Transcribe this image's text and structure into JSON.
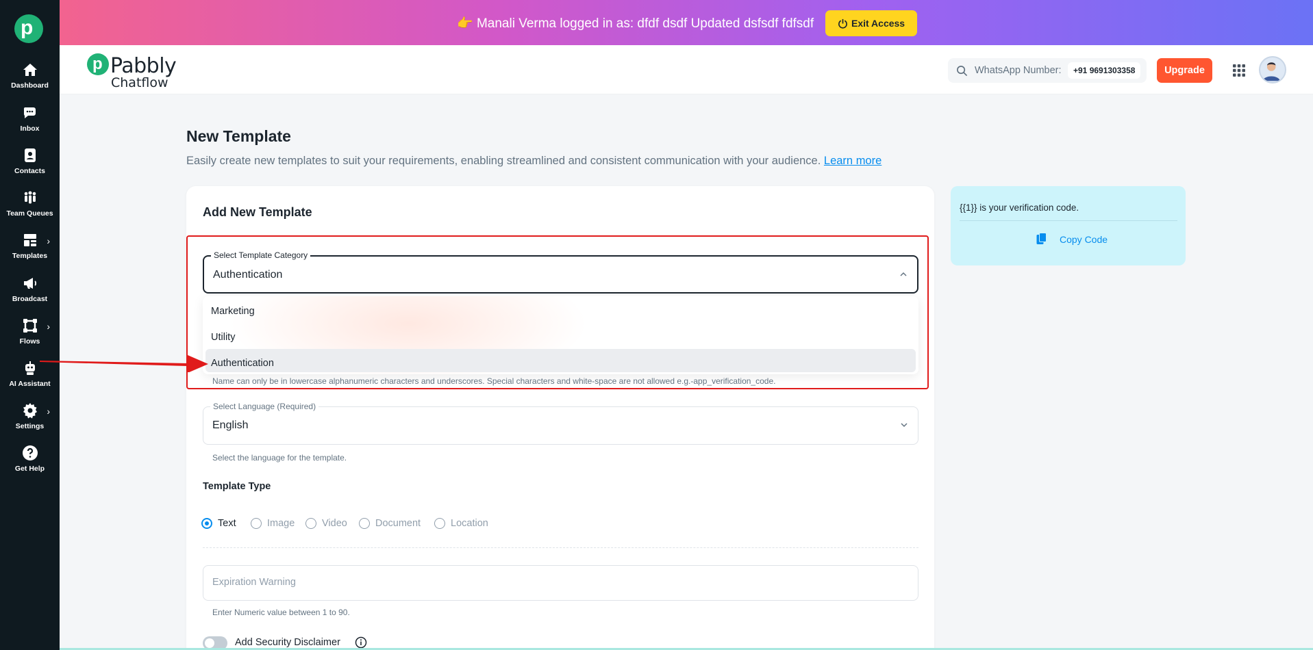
{
  "sidebar": {
    "items": [
      {
        "label": "Dashboard",
        "icon": "home-icon"
      },
      {
        "label": "Inbox",
        "icon": "chat-icon"
      },
      {
        "label": "Contacts",
        "icon": "contact-icon"
      },
      {
        "label": "Team Queues",
        "icon": "team-icon"
      },
      {
        "label": "Templates",
        "icon": "template-icon"
      },
      {
        "label": "Broadcast",
        "icon": "megaphone-icon"
      },
      {
        "label": "Flows",
        "icon": "flow-icon"
      },
      {
        "label": "AI Assistant",
        "icon": "robot-icon"
      },
      {
        "label": "Settings",
        "icon": "gear-icon"
      },
      {
        "label": "Get Help",
        "icon": "help-icon"
      }
    ]
  },
  "banner": {
    "emoji": "👉",
    "text": "Manali Verma logged in as: dfdf dsdf Updated dsfsdf fdfsdf",
    "exit_label": "Exit Access"
  },
  "header": {
    "brand_name": "Pabbly",
    "brand_sub": "Chatflow",
    "whatsapp_label": "WhatsApp Number:",
    "whatsapp_number": "+91 9691303358",
    "upgrade_label": "Upgrade"
  },
  "page": {
    "title": "New Template",
    "subtitle": "Easily create new templates to suit your requirements, enabling streamlined and consistent communication with your audience.",
    "learn_more": "Learn more"
  },
  "form": {
    "card_title": "Add New Template",
    "category": {
      "label": "Select Template Category",
      "value": "Authentication",
      "options": [
        "Marketing",
        "Utility",
        "Authentication"
      ],
      "helper": "Name can only be in lowercase alphanumeric characters and underscores. Special characters and white-space are not allowed e.g.-app_verification_code."
    },
    "language": {
      "label": "Select Language (Required)",
      "value": "English",
      "helper": "Select the language for the template."
    },
    "template_type": {
      "title": "Template Type",
      "options": [
        "Text",
        "Image",
        "Video",
        "Document",
        "Location"
      ],
      "selected": "Text"
    },
    "expiration": {
      "placeholder": "Expiration Warning",
      "helper": "Enter Numeric value between 1 to 90."
    },
    "security_disclaimer_label": "Add Security Disclaimer"
  },
  "preview": {
    "message": "{{1}} is your verification code.",
    "copy_label": "Copy Code"
  },
  "colors": {
    "accent": "#078dee",
    "brand_green": "#20b276",
    "upgrade": "#ff5630",
    "exit": "#ffd41f",
    "annotation": "#e01b1b"
  }
}
